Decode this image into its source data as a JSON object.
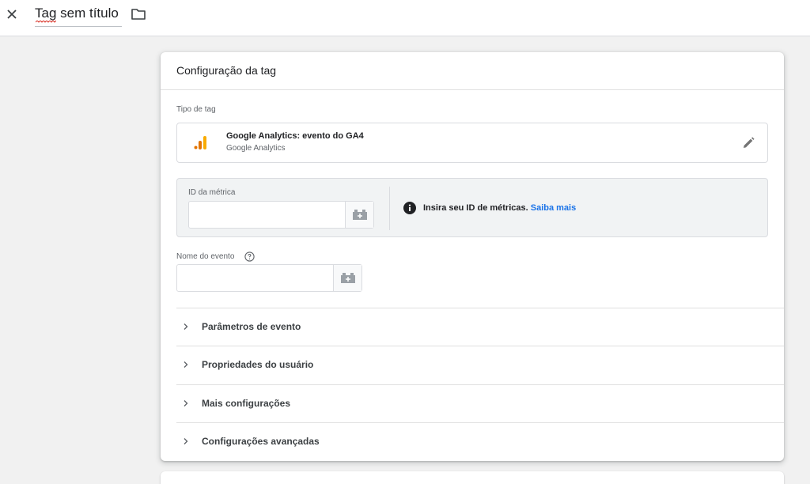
{
  "header": {
    "title": "Tag sem título",
    "close_icon": "close-icon",
    "folder_icon": "folder-icon"
  },
  "config": {
    "title": "Configuração da tag",
    "tag_type_label": "Tipo de tag",
    "tag_type": {
      "name": "Google Analytics: evento do GA4",
      "vendor": "Google Analytics",
      "logo_icon": "google-analytics-icon",
      "edit_icon": "pencil-icon"
    },
    "metric_id": {
      "label": "ID da métrica",
      "value": "",
      "variable_icon": "variable-brick-icon"
    },
    "info": {
      "icon": "info-icon",
      "text": "Insira seu ID de métricas.",
      "link": "Saiba mais"
    },
    "event_name": {
      "label": "Nome do evento",
      "value": "",
      "help_icon": "help-icon"
    },
    "sections": [
      {
        "label": "Parâmetros de evento"
      },
      {
        "label": "Propriedades do usuário"
      },
      {
        "label": "Mais configurações"
      },
      {
        "label": "Configurações avançadas"
      }
    ]
  },
  "colors": {
    "accent_link": "#1a73e8",
    "ga_orange": "#f9ab00",
    "ga_dark_orange": "#e37400",
    "page_bg": "#f1f1f1"
  }
}
